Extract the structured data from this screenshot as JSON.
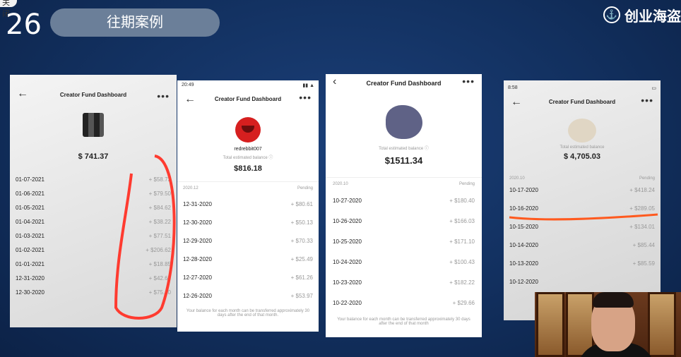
{
  "header": {
    "slide_number": "26",
    "close_label": "关闭",
    "section_label": "往期案例",
    "brand_name": "创业海盗"
  },
  "colors": {
    "background": "#12305f",
    "pill": "#6b7f99",
    "annotation_red": "#ff3b30",
    "annotation_orange": "#ff5a1f"
  },
  "panel1": {
    "title": "Creator Fund Dashboard",
    "balance": "$ 741.37",
    "rows": [
      {
        "date": "01-07-2021",
        "amount": "+ $58.73"
      },
      {
        "date": "01-06-2021",
        "amount": "+ $79.50"
      },
      {
        "date": "01-05-2021",
        "amount": "+ $84.62"
      },
      {
        "date": "01-04-2021",
        "amount": "+ $38.22"
      },
      {
        "date": "01-03-2021",
        "amount": "+ $77.51"
      },
      {
        "date": "01-02-2021",
        "amount": "+ $206.62"
      },
      {
        "date": "01-01-2021",
        "amount": "+ $18.85"
      },
      {
        "date": "12-31-2020",
        "amount": "+ $42.64"
      },
      {
        "date": "12-30-2020",
        "amount": "+ $75.40"
      }
    ]
  },
  "panel2": {
    "time": "20:49",
    "title": "Creator Fund Dashboard",
    "username": "redrebbit007",
    "balance_label": "Total estimated balance ⓘ",
    "balance": "$816.18",
    "month": "2020.12",
    "status": "Pending",
    "rows": [
      {
        "date": "12-31-2020",
        "amount": "+ $80.61"
      },
      {
        "date": "12-30-2020",
        "amount": "+ $50.13"
      },
      {
        "date": "12-29-2020",
        "amount": "+ $70.33"
      },
      {
        "date": "12-28-2020",
        "amount": "+ $25.49"
      },
      {
        "date": "12-27-2020",
        "amount": "+ $61.26"
      },
      {
        "date": "12-26-2020",
        "amount": "+ $53.97"
      }
    ],
    "footer": "Your balance for each month can be transferred approximately 30 days after the end of that month."
  },
  "panel3": {
    "title": "Creator Fund Dashboard",
    "balance_label": "Total estimated balance ⓘ",
    "balance": "$1511.34",
    "month": "2020.10",
    "status": "Pending",
    "rows": [
      {
        "date": "10-27-2020",
        "amount": "+ $180.40"
      },
      {
        "date": "10-26-2020",
        "amount": "+ $166.03"
      },
      {
        "date": "10-25-2020",
        "amount": "+ $171.10"
      },
      {
        "date": "10-24-2020",
        "amount": "+ $100.43"
      },
      {
        "date": "10-23-2020",
        "amount": "+ $182.22"
      },
      {
        "date": "10-22-2020",
        "amount": "+ $29.66"
      }
    ],
    "footer": "Your balance for each month can be transferred approximately 30 days after the end of that month"
  },
  "panel4": {
    "time": "8:58",
    "title": "Creator Fund Dashboard",
    "balance_label": "Total estimated balance",
    "balance": "$ 4,705.03",
    "month": "2020.10",
    "status": "Pending",
    "rows": [
      {
        "date": "10-17-2020",
        "amount": "+ $418.24"
      },
      {
        "date": "10-16-2020",
        "amount": "+ $289.05"
      },
      {
        "date": "10-15-2020",
        "amount": "+ $134.01"
      },
      {
        "date": "10-14-2020",
        "amount": "+ $85.44"
      },
      {
        "date": "10-13-2020",
        "amount": "+ $85.59"
      },
      {
        "date": "10-12-2020",
        "amount": ""
      }
    ]
  }
}
